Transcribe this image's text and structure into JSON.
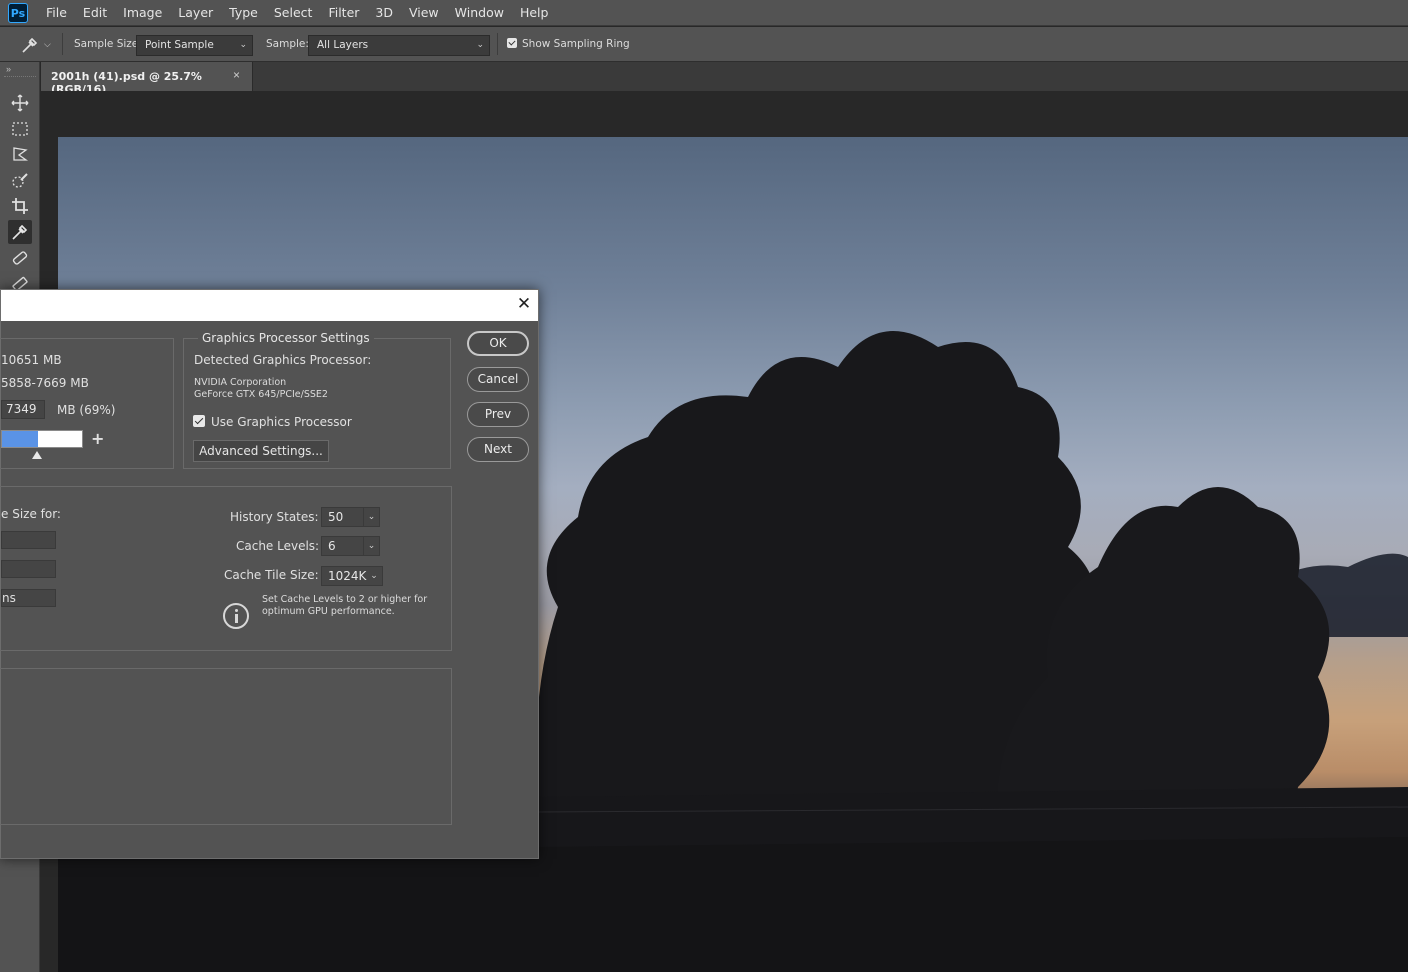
{
  "app": {
    "logo_text": "Ps",
    "menu": [
      "File",
      "Edit",
      "Image",
      "Layer",
      "Type",
      "Select",
      "Filter",
      "3D",
      "View",
      "Window",
      "Help"
    ]
  },
  "options_bar": {
    "sample_size_label": "Sample Size:",
    "sample_size_value": "Point Sample",
    "sample_label": "Sample:",
    "sample_value": "All Layers",
    "show_sampling_ring_label": "Show Sampling Ring",
    "show_sampling_ring_checked": true
  },
  "document_tab": {
    "title": "2001h (41).psd @ 25.7% (RGB/16)",
    "close_glyph": "×"
  },
  "dialog": {
    "close_glyph": "✕",
    "memory": {
      "available_ram_fragment": "10651 MB",
      "ideal_range_fragment": "5858-7669 MB",
      "let_use_value_fragment": "7349",
      "let_use_unit": "MB (69%)",
      "slider_fraction": 0.69,
      "plus_glyph": "+"
    },
    "gpu": {
      "group_title": "Graphics Processor Settings",
      "detected_label": "Detected Graphics Processor:",
      "vendor": "NVIDIA Corporation",
      "model": "GeForce GTX 645/PCIe/SSE2",
      "use_gpu_label": "Use Graphics Processor",
      "use_gpu_checked": true,
      "advanced_button": "Advanced Settings..."
    },
    "history_cache": {
      "left_label_fragment": "e Size for:",
      "left_field_fragment": "ns",
      "history_states_label": "History States:",
      "history_states_value": "50",
      "cache_levels_label": "Cache Levels:",
      "cache_levels_value": "6",
      "cache_tile_size_label": "Cache Tile Size:",
      "cache_tile_size_value": "1024K",
      "info_line1": "Set Cache Levels to 2 or higher for",
      "info_line2": "optimum GPU performance."
    },
    "buttons": {
      "ok": "OK",
      "cancel": "Cancel",
      "prev": "Prev",
      "next": "Next"
    }
  },
  "colors": {
    "ui_panel": "#535353",
    "ui_dark": "#282828",
    "accent_blue": "#5a93e6",
    "ps_blue": "#31a8ff"
  }
}
